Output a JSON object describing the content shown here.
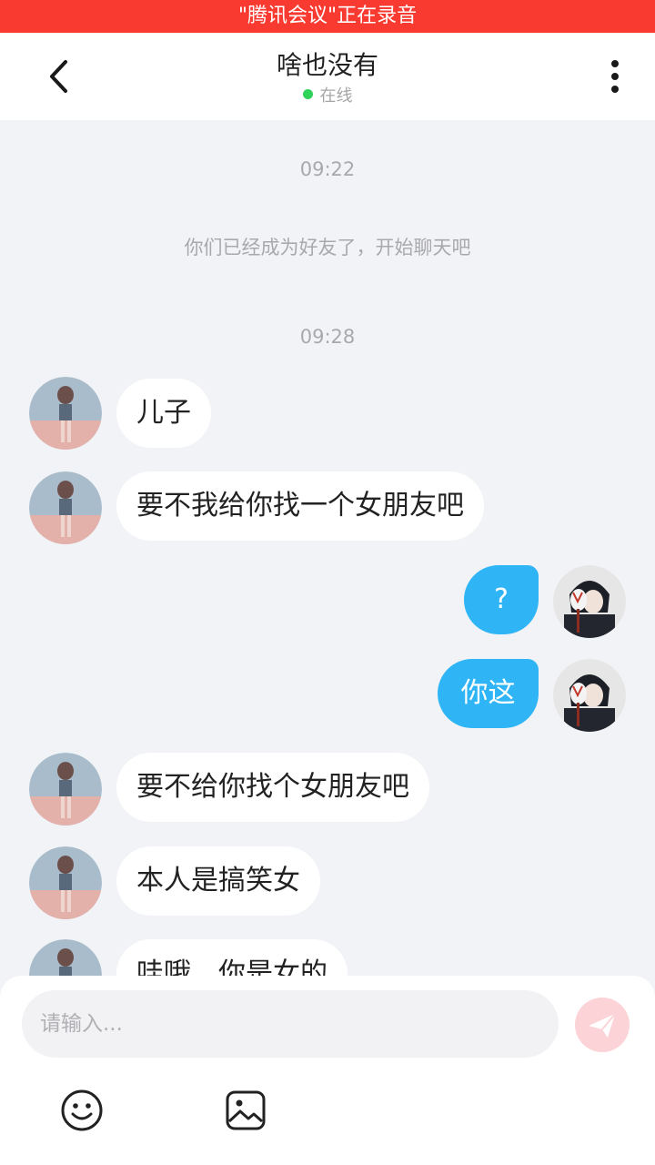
{
  "recording_banner": "\"腾讯会议\"正在录音",
  "header": {
    "title": "啥也没有",
    "status": "在线"
  },
  "chat": {
    "timestamps": [
      "09:22",
      "09:28"
    ],
    "system_message": "你们已经成为好友了，开始聊天吧",
    "messages": [
      {
        "from": "them",
        "text": "儿子"
      },
      {
        "from": "them",
        "text": "要不我给你找一个女朋友吧"
      },
      {
        "from": "me",
        "text": "?"
      },
      {
        "from": "me",
        "text": "你这"
      },
      {
        "from": "them",
        "text": "要不给你找个女朋友吧"
      },
      {
        "from": "them",
        "text": "本人是搞笑女"
      },
      {
        "from": "them",
        "text": "哇哦，你是女的"
      }
    ]
  },
  "composer": {
    "placeholder": "请输入...",
    "icons": [
      "send-icon",
      "emoji-icon",
      "image-icon"
    ]
  },
  "colors": {
    "recording_bar": "#f93a30",
    "outgoing_bubble": "#2fb5f5",
    "incoming_bubble": "#ffffff",
    "online_dot": "#2fd35a",
    "send_button": "#fcd3d6"
  }
}
